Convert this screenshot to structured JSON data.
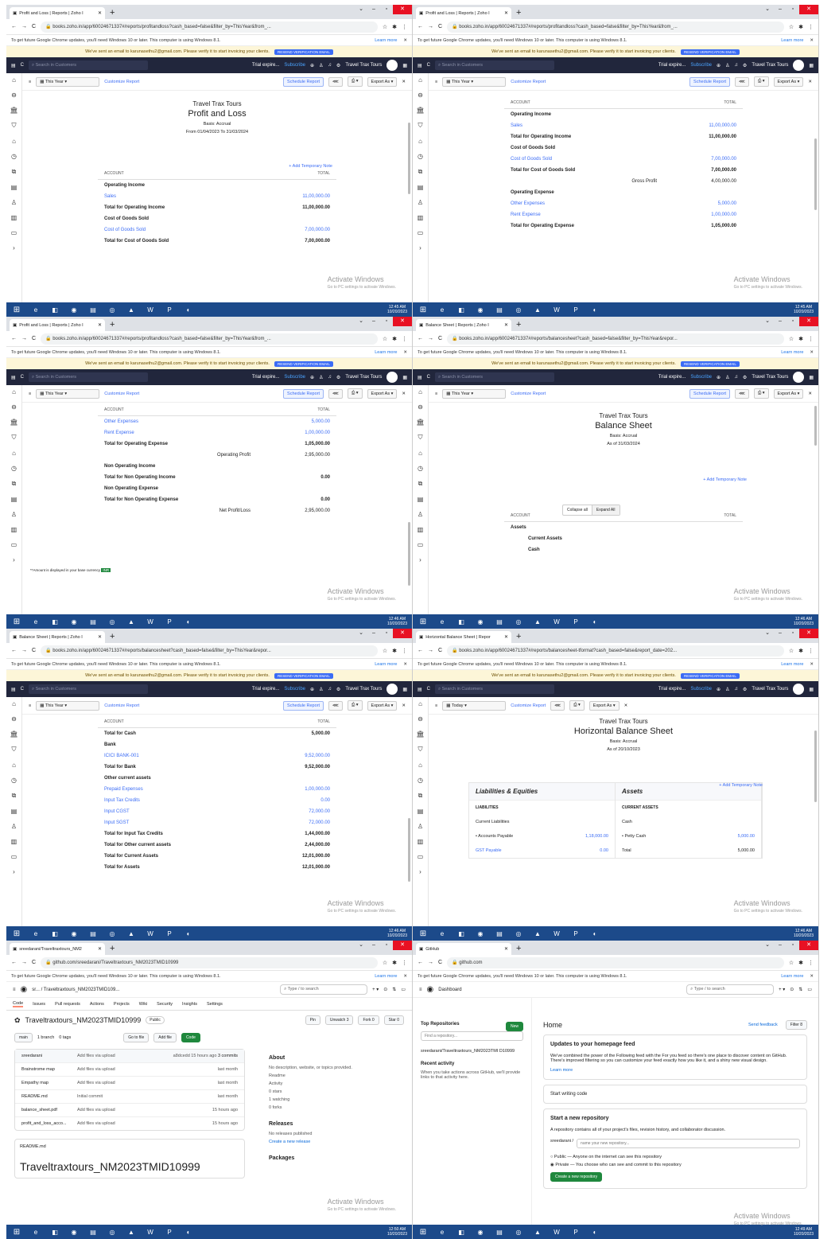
{
  "common": {
    "info_text": "To get future Google Chrome updates, you'll need Windows 10 or later. This computer is using Windows 8.1.",
    "learn_more": "Learn more",
    "verify_text": "We've sent an email to karunasethu2@gmail.com. Please verify it to start invoicing your clients.",
    "verify_btn": "RESEND VERIFICATION EMAIL",
    "search_placeholder": "Search in Customers",
    "trial": "Trial expire...",
    "subscribe": "Subscribe",
    "org": "Travel Trax Tours",
    "this_year": "This Year",
    "customize": "Customize Report",
    "schedule": "Schedule Report",
    "export": "Export As",
    "watermark": "Activate Windows",
    "watermark_sub": "Go to PC settings to activate Windows.",
    "temp_note": "+ Add Temporary Note",
    "account": "ACCOUNT",
    "total": "TOTAL"
  },
  "panels": [
    {
      "tab": "Profit and Loss | Reports | Zoho I",
      "url": "books.zoho.in/app/60024671337#/reports/profitandloss?cash_based=false&filter_by=ThisYear&from_...",
      "clock": "12:45 AM",
      "date": "10/20/2023",
      "title": "Profit and Loss",
      "basis": "Basis: Accrual",
      "range": "From 01/04/2023 To 31/03/2024",
      "rows": [
        [
          "Operating Income",
          "",
          "b"
        ],
        [
          "Sales",
          "11,00,000.00",
          "lnk"
        ],
        [
          "Total for Operating Income",
          "11,00,000.00",
          "b"
        ],
        [
          "Cost of Goods Sold",
          "",
          "b"
        ],
        [
          "Cost of Goods Sold",
          "7,00,000.00",
          "lnk"
        ],
        [
          "Total for Cost of Goods Sold",
          "7,00,000.00",
          "b"
        ]
      ]
    },
    {
      "tab": "Profit and Loss | Reports | Zoho I",
      "url": "books.zoho.in/app/60024671337#/reports/profitandloss?cash_based=false&filter_by=ThisYear&from_...",
      "clock": "12:45 AM",
      "date": "10/20/2023",
      "rows": [
        [
          "Operating Income",
          "",
          "b"
        ],
        [
          "Sales",
          "11,00,000.00",
          "lnk"
        ],
        [
          "Total for Operating Income",
          "11,00,000.00",
          "b"
        ],
        [
          "Cost of Goods Sold",
          "",
          "b"
        ],
        [
          "Cost of Goods Sold",
          "7,00,000.00",
          "lnk"
        ],
        [
          "Total for Cost of Goods Sold",
          "7,00,000.00",
          "b"
        ],
        [
          "Gross Profit",
          "4,00,000.00",
          "mid"
        ],
        [
          "Operating Expense",
          "",
          "b"
        ],
        [
          "Other Expenses",
          "5,000.00",
          "lnk"
        ],
        [
          "Rent Expense",
          "1,00,000.00",
          "lnk"
        ],
        [
          "Total for Operating Expense",
          "1,05,000.00",
          "b"
        ]
      ]
    },
    {
      "tab": "Profit and Loss | Reports | Zoho I",
      "url": "books.zoho.in/app/60024671337#/reports/profitandloss?cash_based=false&filter_by=ThisYear&from_...",
      "clock": "12:46 AM",
      "date": "10/20/2023",
      "rows": [
        [
          "Other Expenses",
          "5,000.00",
          "lnk"
        ],
        [
          "Rent Expense",
          "1,00,000.00",
          "lnk"
        ],
        [
          "Total for Operating Expense",
          "1,05,000.00",
          "b"
        ],
        [
          "Operating Profit",
          "2,95,000.00",
          "mid"
        ],
        [
          "Non Operating Income",
          "",
          "b"
        ],
        [
          "Total for Non Operating Income",
          "0.00",
          "b"
        ],
        [
          "Non Operating Expense",
          "",
          "b"
        ],
        [
          "Total for Non Operating Expense",
          "0.00",
          "b"
        ],
        [
          "Net Profit/Loss",
          "2,95,000.00",
          "mid"
        ]
      ],
      "footnote": "**Amount is displayed in your base currency",
      "inr": "INR"
    },
    {
      "tab": "Balance Sheet | Reports | Zoho I",
      "url": "books.zoho.in/app/60024671337#/reports/balancesheet?cash_based=false&filter_by=ThisYear&repor...",
      "clock": "12:46 AM",
      "date": "10/20/2023",
      "title": "Balance Sheet",
      "basis": "Basis: Accrual",
      "range": "As of 31/03/2024",
      "collapse": "Collapse all",
      "expand": "Expand All",
      "rows": [
        [
          "Assets",
          "",
          "b"
        ],
        [
          "Current Assets",
          "",
          "b ind"
        ],
        [
          "Cash",
          "",
          "b ind"
        ]
      ]
    },
    {
      "tab": "Balance Sheet | Reports | Zoho I",
      "url": "books.zoho.in/app/60024671337#/reports/balancesheet?cash_based=false&filter_by=ThisYear&repor...",
      "clock": "12:46 AM",
      "date": "10/20/2023",
      "rows": [
        [
          "Total for Cash",
          "5,000.00",
          "b"
        ],
        [
          "Bank",
          "",
          "b"
        ],
        [
          "ICICI BANK-001",
          "9,52,000.00",
          "lnk"
        ],
        [
          "Total for Bank",
          "9,52,000.00",
          "b"
        ],
        [
          "Other current assets",
          "",
          "b"
        ],
        [
          "Prepaid Expenses",
          "1,00,000.00",
          "lnk"
        ],
        [
          "Input Tax Credits",
          "0.00",
          "lnk"
        ],
        [
          "Input CGST",
          "72,000.00",
          "lnk"
        ],
        [
          "Input SGST",
          "72,000.00",
          "lnk"
        ],
        [
          "Total for Input Tax Credits",
          "1,44,000.00",
          "b"
        ],
        [
          "Total for Other current assets",
          "2,44,000.00",
          "b"
        ],
        [
          "Total for Current Assets",
          "12,01,000.00",
          "b"
        ],
        [
          "Total for Assets",
          "12,01,000.00",
          "b"
        ]
      ]
    },
    {
      "tab": "Horizontal Balance Sheet | Repor",
      "url": "books.zoho.in/app/60024671337#/reports/balancesheet-tformat?cash_based=false&report_date=202...",
      "clock": "12:46 AM",
      "date": "10/20/2023",
      "today": "Today",
      "title": "Horizontal Balance Sheet",
      "basis": "Basis: Accrual",
      "range": "As of 20/10/2023",
      "liab": "Liabilities & Equities",
      "assets": "Assets",
      "liab_sub": "LIABILITIES",
      "cur_liab": "Current Liabilities",
      "ap": "• Accounts Payable",
      "ap_v": "1,18,000.00",
      "gst": "GST Payable",
      "gst_v": "0.00",
      "cur_assets": "CURRENT ASSETS",
      "cash": "Cash",
      "petty": "• Petty Cash",
      "petty_v": "5,000.00",
      "total_lbl": "Total",
      "total_v": "5,000.00"
    },
    {
      "tab": "sreedarani/Traveltraxtours_NM2",
      "url": "github.com/sreedarani/Traveltraxtours_NM2023TMID10999",
      "clock": "12:50 AM",
      "date": "10/20/2023",
      "crumb": "sr... / Traveltraxtours_NM2023TMID109...",
      "search": "Type / to search",
      "tabs": [
        "Code",
        "Issues",
        "Pull requests",
        "Actions",
        "Projects",
        "Wiki",
        "Security",
        "Insights",
        "Settings"
      ],
      "repo": "Traveltraxtours_NM2023TMID10999",
      "public": "Public",
      "pin": "Pin",
      "unwatch": "Unwatch",
      "unwatch_n": "3",
      "fork": "Fork",
      "fork_n": "0",
      "star": "Star",
      "star_n": "0",
      "branch": "main",
      "branches": "1 branch",
      "tags": "0 tags",
      "goto": "Go to file",
      "addfile": "Add file",
      "code": "Code",
      "commit_user": "sreedarani",
      "commit_msg": "Add files via upload",
      "commit_hash": "a8dcedd",
      "commit_time": "15 hours ago",
      "commits": "3 commits",
      "files": [
        [
          "Brainstrome map",
          "Add files via upload",
          "last month"
        ],
        [
          "Empathy map",
          "Add files via upload",
          "last month"
        ],
        [
          "README.md",
          "Initial commit",
          "last month"
        ],
        [
          "balance_sheet.pdf",
          "Add files via upload",
          "15 hours ago"
        ],
        [
          "profit_and_loss_acco...",
          "Add files via upload",
          "15 hours ago"
        ]
      ],
      "about": "About",
      "about_desc": "No description, website, or topics provided.",
      "readme_l": "Readme",
      "activity": "Activity",
      "stars": "0 stars",
      "watching": "1 watching",
      "forks": "0 forks",
      "releases": "Releases",
      "no_rel": "No releases published",
      "new_rel": "Create a new release",
      "packages": "Packages",
      "readme_file": "README.md",
      "readme_title": "Traveltraxtours_NM2023TMID10999"
    },
    {
      "tab": "GitHub",
      "url": "github.com",
      "clock": "12:49 AM",
      "date": "10/20/2023",
      "dashboard": "Dashboard",
      "search": "Type / to search",
      "top_repos": "Top Repositories",
      "new": "New",
      "find": "Find a repository...",
      "repo": "sreedarani/Traveltraxtours_NM2023TMI D10999",
      "recent": "Recent activity",
      "recent_text": "When you take actions across GitHub, we'll provide links to that activity here.",
      "home": "Home",
      "feedback": "Send feedback",
      "filter": "Filter",
      "filter_n": "8",
      "upd_title": "Updates to your homepage feed",
      "upd_text": "We've combined the power of the Following feed with the For you feed so there's one place to discover content on GitHub. There's improved filtering so you can customize your feed exactly how you like it, and a shiny new visual design.",
      "learn": "Learn more",
      "start_code": "Start writing code",
      "start_repo": "Start a new repository",
      "start_text": "A repository contains all of your project's files, revision history, and collaborator discussion.",
      "owner": "sreedarani /",
      "name_ph": "name your new repository...",
      "pub": "Public",
      "pub_d": "Anyone on the internet can see this repository",
      "priv": "Private",
      "priv_d": "You choose who can see and commit to this repository",
      "create": "Create a new repository"
    }
  ]
}
